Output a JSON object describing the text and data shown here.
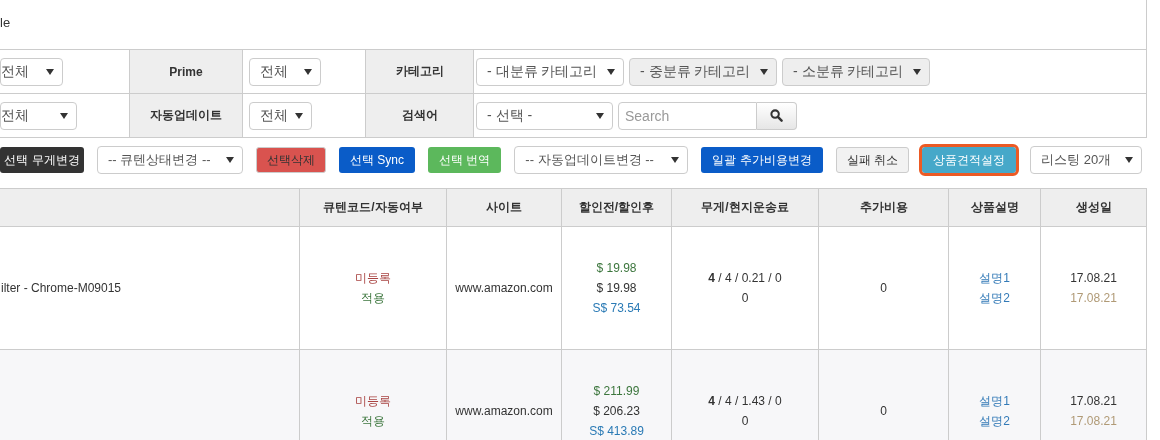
{
  "header": {
    "title": "le"
  },
  "filters": [
    {
      "cells": [
        {
          "kind": "select",
          "value": "전체",
          "disabled": false
        },
        {
          "kind": "label",
          "text": "Prime"
        },
        {
          "kind": "select",
          "value": "전체",
          "disabled": false
        },
        {
          "kind": "label",
          "text": "카테고리"
        },
        {
          "kind": "selects",
          "items": [
            {
              "value": "- 대분류 카테고리",
              "disabled": false
            },
            {
              "value": "- 중분류 카테고리",
              "disabled": true
            },
            {
              "value": "- 소분류 카테고리",
              "disabled": true
            }
          ]
        }
      ]
    },
    {
      "cells": [
        {
          "kind": "select",
          "value": "전체",
          "disabled": false
        },
        {
          "kind": "label",
          "text": "자동업데이트"
        },
        {
          "kind": "select",
          "value": "전체",
          "disabled": false
        },
        {
          "kind": "label",
          "text": "검색어"
        },
        {
          "kind": "search",
          "select": "- 선택 -",
          "placeholder": "Search"
        }
      ]
    }
  ],
  "toolbar": [
    {
      "kind": "button",
      "color": "#333333",
      "label": "선택 무게변경",
      "highlighted": false
    },
    {
      "kind": "select",
      "value": "-- 큐텐상태변경 --"
    },
    {
      "kind": "button",
      "color": "#d9534f",
      "label": "선택삭제",
      "highlighted": false
    },
    {
      "kind": "button",
      "color": "#0a5cc8",
      "label": "선택 Sync",
      "highlighted": false
    },
    {
      "kind": "button",
      "color": "#5cb85c",
      "label": "선택 번역",
      "highlighted": false
    },
    {
      "kind": "select",
      "value": "-- 자동업데이트변경 --"
    },
    {
      "kind": "button",
      "color": "#0a5cc8",
      "label": "일괄 추가비용변경",
      "highlighted": false
    },
    {
      "kind": "button",
      "color": "#f2f2f2",
      "label": "실패 취소",
      "highlighted": false
    },
    {
      "kind": "button",
      "color": "#46a8c9",
      "label": "상품견적설정",
      "highlighted": true
    },
    {
      "kind": "select",
      "value": "리스팅 20개"
    }
  ],
  "table": {
    "columns": [
      "큐텐코드/자동여부",
      "사이트",
      "할인전/할인후",
      "무게/현지운송료",
      "추가비용",
      "상품설명",
      "생성일"
    ],
    "rows": [
      {
        "title": "ilter - Chrome-M09015",
        "code_status": "미등록",
        "auto_status": "적용",
        "site": "www.amazon.com",
        "price_before": "$ 19.98",
        "price_after": "$ 19.98",
        "price_sgd": "S$ 73.54",
        "weight": "**4** / 4 / 0.21 / 0",
        "shipping": "0",
        "extra_cost": "0",
        "descriptions": [
          "설명1",
          "설명2"
        ],
        "created": "17.08.21",
        "updated": "17.08.21"
      },
      {
        "code_status": "미등록",
        "auto_status": "적용",
        "site": "www.amazon.com",
        "price_before": "$ 211.99",
        "price_after": "$ 206.23",
        "price_sgd": "S$ 413.89",
        "weight": "**4** / 4 / 1.43 / 0",
        "shipping": "0",
        "extra_cost": "0",
        "descriptions": [
          "설명1",
          "설명2"
        ],
        "created": "17.08.21",
        "updated": "17.08.21"
      }
    ]
  }
}
